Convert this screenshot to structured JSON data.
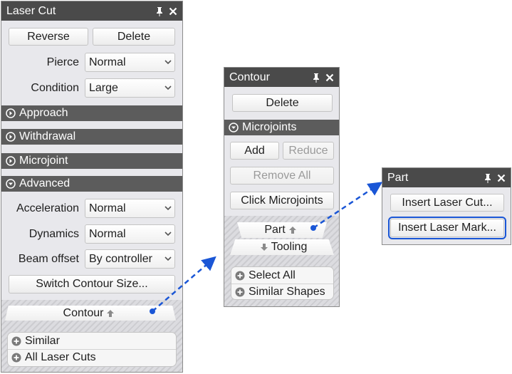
{
  "laser_cut": {
    "title": "Laser Cut",
    "reverse": "Reverse",
    "delete": "Delete",
    "pierce_label": "Pierce",
    "pierce_value": "Normal",
    "condition_label": "Condition",
    "condition_value": "Large",
    "sections": [
      "Approach",
      "Withdrawal",
      "Microjoint",
      "Advanced"
    ],
    "acceleration_label": "Acceleration",
    "acceleration_value": "Normal",
    "dynamics_label": "Dynamics",
    "dynamics_value": "Normal",
    "beam_offset_label": "Beam offset",
    "beam_offset_value": "By controller",
    "switch_contour": "Switch Contour Size...",
    "contour_nav": "Contour",
    "similar": "Similar",
    "all_laser_cuts": "All Laser Cuts"
  },
  "contour": {
    "title": "Contour",
    "delete": "Delete",
    "section": "Microjoints",
    "add": "Add",
    "reduce": "Reduce",
    "remove_all": "Remove All",
    "click_microjoints": "Click Microjoints",
    "part_nav": "Part",
    "tooling_nav": "Tooling",
    "select_all": "Select All",
    "similar_shapes": "Similar Shapes"
  },
  "part": {
    "title": "Part",
    "insert_laser_cut": "Insert Laser Cut...",
    "insert_laser_mark": "Insert Laser Mark..."
  },
  "colors": {
    "titlebar": "#4a4a4a",
    "section_header": "#5c5c5c",
    "panel_bg": "#e8e8ec",
    "connector": "#1a56d6",
    "highlight": "#1a56d6"
  }
}
